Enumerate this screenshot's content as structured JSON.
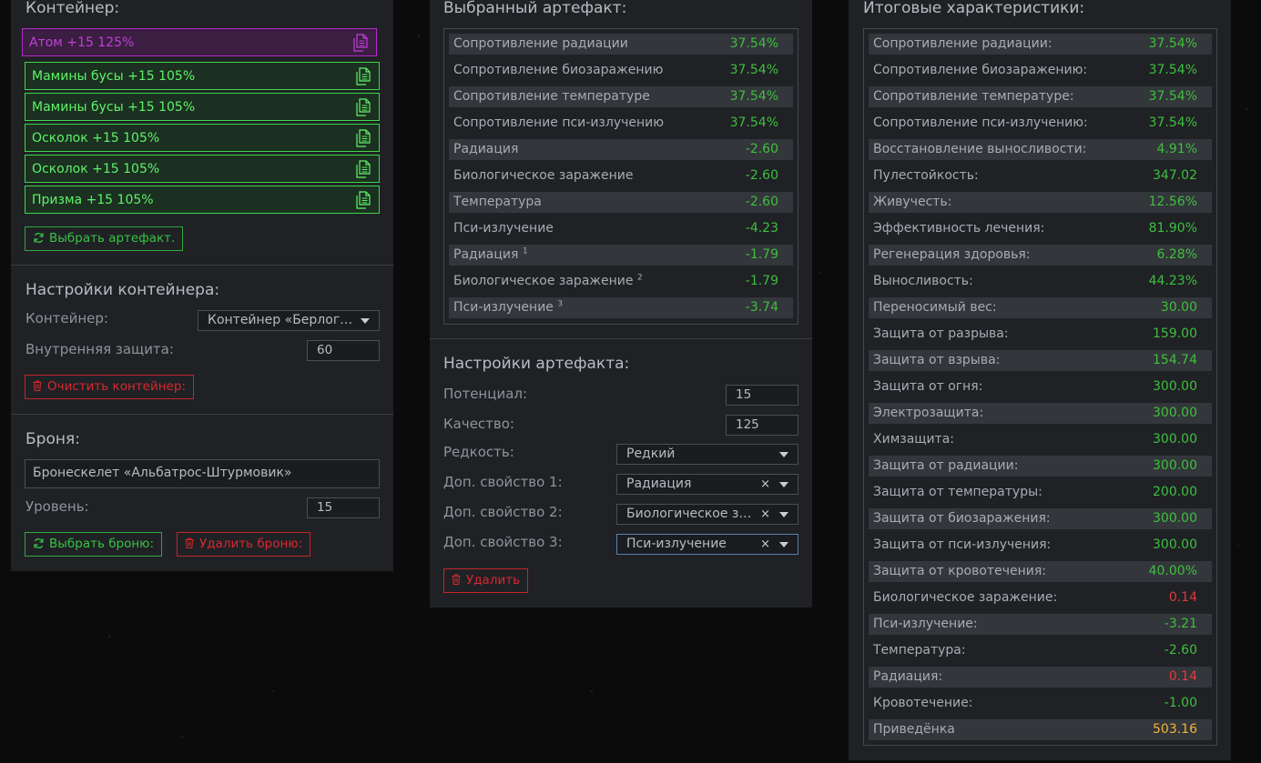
{
  "container_section": {
    "title": "Контейнер:",
    "artifacts": [
      {
        "label": "Атом +15 125%",
        "selected": true
      },
      {
        "label": "Мамины бусы +15 105%"
      },
      {
        "label": "Мамины бусы +15 105%"
      },
      {
        "label": "Осколок +15 105%"
      },
      {
        "label": "Осколок +15 105%"
      },
      {
        "label": "Призма +15 105%"
      }
    ],
    "choose_artifact_label": "Выбрать артефакт."
  },
  "container_settings": {
    "title": "Настройки контейнера:",
    "container_label": "Контейнер:",
    "container_value": "Контейнер «Берлога...",
    "inner_protection_label": "Внутренняя защита:",
    "inner_protection_value": "60",
    "clear_label": "Очистить контейнер:"
  },
  "armor": {
    "title": "Броня:",
    "name": "Бронескелет «Альбатрос-Штурмовик»",
    "level_label": "Уровень:",
    "level_value": "15",
    "choose_label": "Выбрать броню:",
    "delete_label": "Удалить броню:"
  },
  "selected_artifact": {
    "title": "Выбранный артефакт:",
    "stats": [
      {
        "name": "Сопротивление радиации",
        "value": "37.54%"
      },
      {
        "name": "Сопротивление биозаражению",
        "value": "37.54%"
      },
      {
        "name": "Сопротивление температуре",
        "value": "37.54%"
      },
      {
        "name": "Сопротивление пси-излучению",
        "value": "37.54%"
      },
      {
        "name": "Радиация",
        "value": "-2.60"
      },
      {
        "name": "Биологическое заражение",
        "value": "-2.60"
      },
      {
        "name": "Температура",
        "value": "-2.60"
      },
      {
        "name": "Пси-излучение",
        "value": "-4.23"
      },
      {
        "name": "Радиация",
        "sup": "1",
        "value": "-1.79"
      },
      {
        "name": "Биологическое заражение",
        "sup": "2",
        "value": "-1.79"
      },
      {
        "name": "Пси-излучение",
        "sup": "3",
        "value": "-3.74"
      }
    ]
  },
  "artifact_settings": {
    "title": "Настройки артефакта:",
    "potential_label": "Потенциал:",
    "potential_value": "15",
    "quality_label": "Качество:",
    "quality_value": "125",
    "rarity_label": "Редкость:",
    "rarity_value": "Редкий",
    "extra1_label": "Доп. свойство 1:",
    "extra1_value": "Радиация",
    "extra2_label": "Доп. свойство 2:",
    "extra2_value": "Биологическое за...",
    "extra3_label": "Доп. свойство 3:",
    "extra3_value": "Пси-излучение",
    "clear_symbol": "×",
    "delete_label": "Удалить"
  },
  "totals": {
    "title": "Итоговые характеристики:",
    "stats": [
      {
        "name": "Сопротивление радиации:",
        "value": "37.54%",
        "color": "g"
      },
      {
        "name": "Сопротивление биозаражению:",
        "value": "37.54%",
        "color": "g"
      },
      {
        "name": "Сопротивление температуре:",
        "value": "37.54%",
        "color": "g"
      },
      {
        "name": "Сопротивление пси-излучению:",
        "value": "37.54%",
        "color": "g"
      },
      {
        "name": "Восстановление выносливости:",
        "value": "4.91%",
        "color": "g"
      },
      {
        "name": "Пулестойкость:",
        "value": "347.02",
        "color": "g"
      },
      {
        "name": "Живучесть:",
        "value": "12.56%",
        "color": "g"
      },
      {
        "name": "Эффективность лечения:",
        "value": "81.90%",
        "color": "g"
      },
      {
        "name": "Регенерация здоровья:",
        "value": "6.28%",
        "color": "g"
      },
      {
        "name": "Выносливость:",
        "value": "44.23%",
        "color": "g"
      },
      {
        "name": "Переносимый вес:",
        "value": "30.00",
        "color": "g"
      },
      {
        "name": "Защита от разрыва:",
        "value": "159.00",
        "color": "g"
      },
      {
        "name": "Защита от взрыва:",
        "value": "154.74",
        "color": "g"
      },
      {
        "name": "Защита от огня:",
        "value": "300.00",
        "color": "g"
      },
      {
        "name": "Электрозащита:",
        "value": "300.00",
        "color": "g"
      },
      {
        "name": "Химзащита:",
        "value": "300.00",
        "color": "g"
      },
      {
        "name": "Защита от радиации:",
        "value": "300.00",
        "color": "g"
      },
      {
        "name": "Защита от температуры:",
        "value": "200.00",
        "color": "g"
      },
      {
        "name": "Защита от биозаражения:",
        "value": "300.00",
        "color": "g"
      },
      {
        "name": "Защита от пси-излучения:",
        "value": "300.00",
        "color": "g"
      },
      {
        "name": "Защита от кровотечения:",
        "value": "40.00%",
        "color": "g"
      },
      {
        "name": "Биологическое заражение:",
        "value": "0.14",
        "color": "r"
      },
      {
        "name": "Пси-излучение:",
        "value": "-3.21",
        "color": "g"
      },
      {
        "name": "Температура:",
        "value": "-2.60",
        "color": "g"
      },
      {
        "name": "Радиация:",
        "value": "0.14",
        "color": "r"
      },
      {
        "name": "Кровотечение:",
        "value": "-1.00",
        "color": "g"
      },
      {
        "name": "Приведёнка",
        "value": "503.16",
        "color": "y"
      }
    ]
  },
  "colors": {
    "green": "#3fbf3e",
    "red": "#e03a3a",
    "yellow": "#f0b43a",
    "purple": "#c23fd8"
  }
}
